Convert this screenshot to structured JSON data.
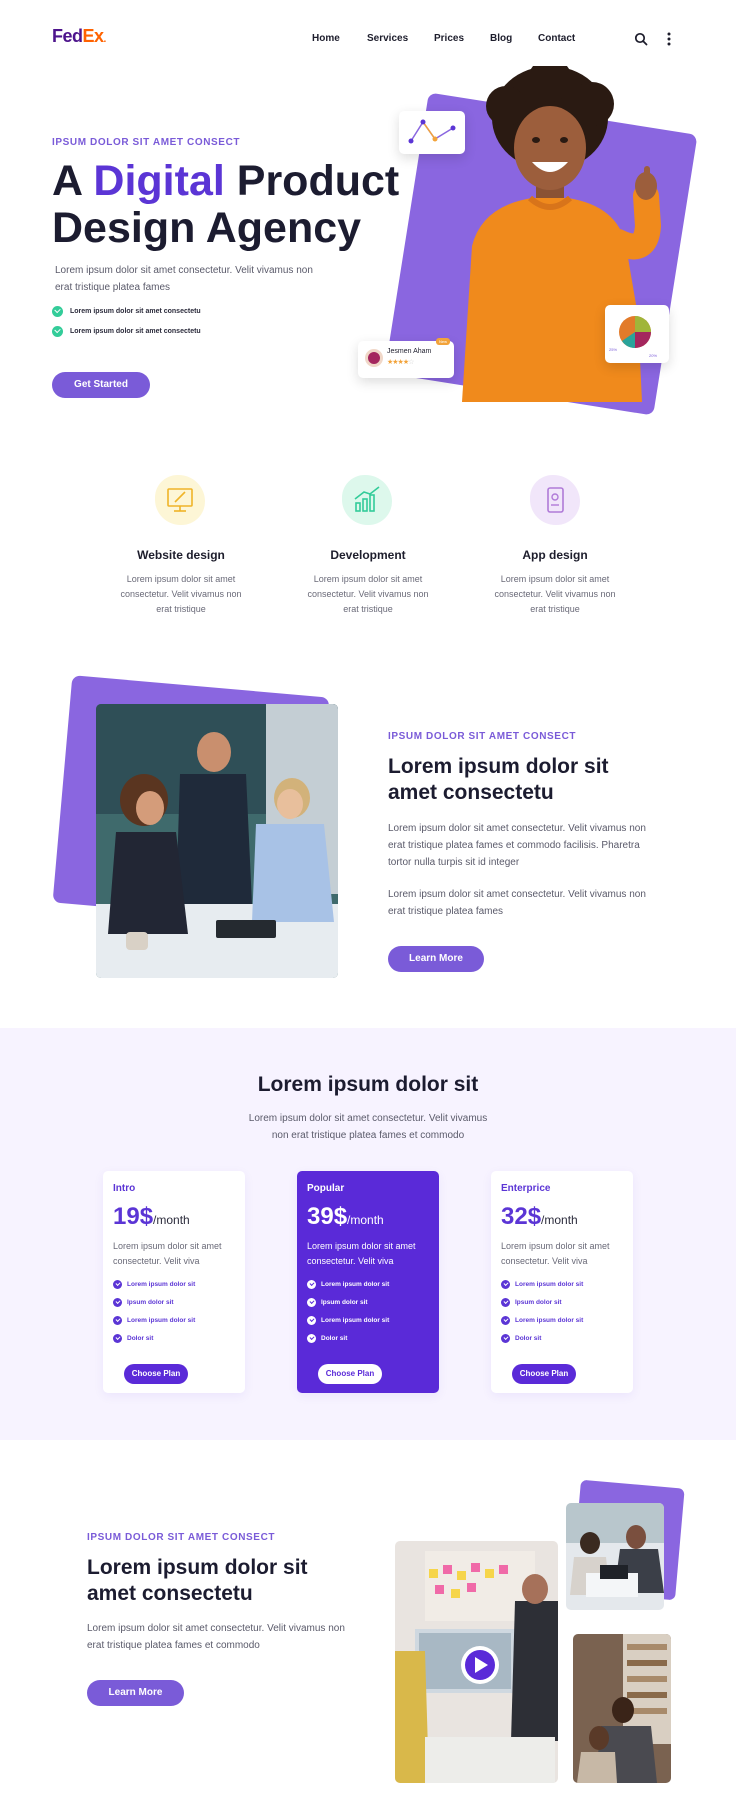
{
  "header": {
    "logo": {
      "part1": "Fed",
      "part2": "Ex",
      "dot": "."
    },
    "nav": [
      "Home",
      "Services",
      "Prices",
      "Blog",
      "Contact"
    ]
  },
  "hero": {
    "eyebrow": "IPSUM DOLOR SIT AMET CONSECT",
    "title_a": "A ",
    "title_accent": "Digital",
    "title_b": " Product",
    "title_line2": "Design Agency",
    "desc": "Lorem ipsum dolor sit amet consectetur. Velit vivamus non erat tristique platea fames",
    "checks": [
      "Lorem ipsum dolor sit amet consectetu",
      "Lorem ipsum dolor sit amet consectetu"
    ],
    "cta": "Get Started",
    "review": {
      "name": "Jesmen Aham",
      "badge": "New"
    },
    "pie_labels": [
      "25%",
      "20%"
    ]
  },
  "services": [
    {
      "title": "Website design",
      "text": "Lorem ipsum dolor sit amet consectetur. Velit vivamus non erat tristique"
    },
    {
      "title": "Development",
      "text": "Lorem ipsum dolor sit amet consectetur. Velit vivamus non erat tristique"
    },
    {
      "title": "App design",
      "text": "Lorem ipsum dolor sit amet consectetur. Velit vivamus non erat tristique"
    }
  ],
  "about": {
    "eyebrow": "IPSUM DOLOR SIT AMET CONSECT",
    "title": "Lorem ipsum dolor sit amet consectetu",
    "p1": "Lorem ipsum dolor sit amet consectetur. Velit vivamus non erat tristique platea fames et commodo facilisis. Pharetra tortor nulla turpis sit id integer",
    "p2": "Lorem ipsum dolor sit amet consectetur. Velit vivamus non erat tristique platea fames",
    "cta": "Learn More"
  },
  "pricing": {
    "title": "Lorem ipsum dolor sit",
    "desc": "Lorem ipsum dolor sit amet consectetur. Velit vivamus non erat tristique platea fames et commodo",
    "plans": [
      {
        "name": "Intro",
        "price": "19$",
        "per": "/month",
        "desc": "Lorem ipsum dolor sit amet consectetur. Velit viva",
        "features": [
          "Lorem ipsum dolor sit",
          "Ipsum dolor sit",
          "Lorem ipsum dolor sit",
          "Dolor sit"
        ],
        "cta": "Choose Plan"
      },
      {
        "name": "Popular",
        "price": "39$",
        "per": "/month",
        "desc": "Lorem ipsum dolor sit amet consectetur. Velit viva",
        "features": [
          "Lorem ipsum dolor sit",
          "Ipsum dolor sit",
          "Lorem ipsum dolor sit",
          "Dolor sit"
        ],
        "cta": "Choose Plan"
      },
      {
        "name": "Enterprice",
        "price": "32$",
        "per": "/month",
        "desc": "Lorem ipsum dolor sit amet consectetur. Velit viva",
        "features": [
          "Lorem ipsum dolor sit",
          "Ipsum dolor sit",
          "Lorem ipsum dolor sit",
          "Dolor sit"
        ],
        "cta": "Choose Plan"
      }
    ]
  },
  "video": {
    "eyebrow": "IPSUM DOLOR SIT AMET CONSECT",
    "title": "Lorem ipsum dolor sit amet consectetu",
    "desc": "Lorem ipsum dolor sit amet consectetur. Velit vivamus non erat tristique platea fames et commodo",
    "cta": "Learn More"
  },
  "colors": {
    "accent": "#5b35d5",
    "soft_purple": "#7a5bd8",
    "check_green": "#33cc99",
    "pricing_bg": "#f7f3ff"
  }
}
